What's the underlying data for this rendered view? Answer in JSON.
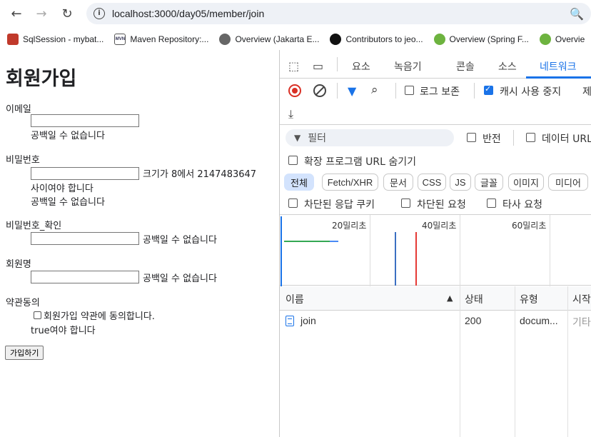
{
  "browser": {
    "url": "localhost:3000/day05/member/join",
    "bookmarks": [
      {
        "label": "SqlSession - mybat...",
        "icon": "sql-icon"
      },
      {
        "label": "Maven Repository:...",
        "icon": "mvn-icon"
      },
      {
        "label": "Overview (Jakarta E...",
        "icon": "globe-icon"
      },
      {
        "label": "Contributors to jeo...",
        "icon": "github-icon"
      },
      {
        "label": "Overview (Spring F...",
        "icon": "spring-icon"
      },
      {
        "label": "Overvie",
        "icon": "spring-icon"
      }
    ]
  },
  "form": {
    "title": "회원가입",
    "email_label": "이메일",
    "email_error": "공백일 수 없습니다",
    "password_label": "비밀번호",
    "password_error_size_1": "크기가 8에서 2147483647",
    "password_error_size_2": "사이여야 합니다",
    "password_error_blank": "공백일 수 없습니다",
    "password_confirm_label": "비밀번호_확인",
    "password_confirm_error": "공백일 수 없습니다",
    "name_label": "회원명",
    "name_error": "공백일 수 없습니다",
    "terms_label": "약관동의",
    "terms_checkbox_label": "회원가입 약관에 동의합니다.",
    "terms_error": "true여야 합니다",
    "submit_label": "가입하기"
  },
  "devtools": {
    "tabs": [
      "요소",
      "녹음기",
      "콘솔",
      "소스",
      "네트워크"
    ],
    "active_tab": "네트워크",
    "preserve_log_label": "로그 보존",
    "disable_cache_label": "캐시 사용 중지",
    "disable_cache_checked": true,
    "throttle_label": "제",
    "filter_placeholder": "필터",
    "invert_label": "반전",
    "data_url_label": "데이터 URL",
    "hide_ext_label": "확장 프로그램 URL 숨기기",
    "type_filters": [
      "전체",
      "Fetch/XHR",
      "문서",
      "CSS",
      "JS",
      "글꼴",
      "이미지",
      "미디어"
    ],
    "blocked_cookies_label": "차단된 응답 쿠키",
    "blocked_requests_label": "차단된 요청",
    "third_party_label": "타사 요청",
    "timeline_ticks": [
      "20밀리초",
      "40밀리초",
      "60밀리초"
    ],
    "columns": [
      "이름",
      "상태",
      "유형",
      "시작"
    ],
    "rows": [
      {
        "name": "join",
        "status": "200",
        "type": "docum...",
        "initiator": "기타"
      }
    ],
    "colors": {
      "accent": "#1a73e8",
      "record": "#d93025",
      "dcl": "#3b6fc2",
      "load": "#e53935",
      "bar_green": "#34a853"
    }
  }
}
